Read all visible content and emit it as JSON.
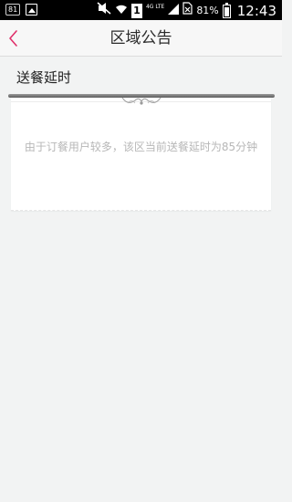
{
  "status_bar": {
    "notification_badge": "81",
    "network_type": "4G LTE",
    "sim_slot": "1",
    "battery_percent": "81%",
    "time": "12:43",
    "icons": [
      "notification-icon",
      "gallery-icon",
      "mute-icon",
      "wifi-icon",
      "sim-icon",
      "signal-icon",
      "no-sim-icon",
      "battery-icon"
    ]
  },
  "header": {
    "title": "区域公告",
    "back_icon": "chevron-left-icon",
    "accent_color": "#e0306a"
  },
  "section": {
    "title": "送餐延时"
  },
  "notice": {
    "text": "由于订餐用户较多，该区当前送餐延时为85分钟"
  }
}
